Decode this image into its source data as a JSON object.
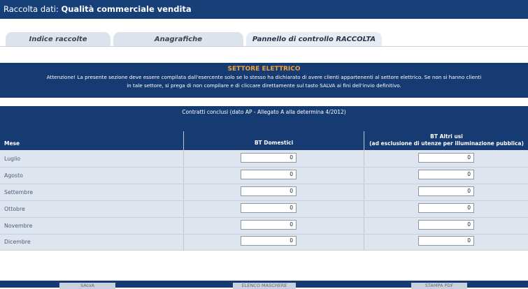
{
  "header": {
    "prefix": "Raccolta dati:",
    "title": "Qualità commerciale vendita"
  },
  "tabs": [
    {
      "label": "Indice raccolte",
      "active": false
    },
    {
      "label": "Anagrafiche",
      "active": false
    },
    {
      "label": "Pannello di controllo RACCOLTA",
      "active": true
    }
  ],
  "notice": {
    "heading": "SETTORE ELETTRICO",
    "line1": "Attenzione! La presente sezione deve essere compilata dall'esercente solo se lo stesso ha dichiarato di avere clienti appartenenti al settore elettrico. Se non si hanno clienti",
    "line2": "in tale settore, si prega di non compilare e di cliccare direttamente sul tasto SALVA ai fini dell'invio definitivo."
  },
  "table": {
    "caption": "Contratti conclusi (dato AP - Allegato A alla determina 4/2012)",
    "col_month": "Mese",
    "col_bt_domestici": "BT Domestici",
    "col_bt_altri": "BT Altri usi",
    "col_bt_altri_note": "(ad esclusione di utenze per illuminazione pubblica)",
    "rows": [
      {
        "month": "Luglio",
        "bt_domestici": "0",
        "bt_altri": "0"
      },
      {
        "month": "Agosto",
        "bt_domestici": "0",
        "bt_altri": "0"
      },
      {
        "month": "Settembre",
        "bt_domestici": "0",
        "bt_altri": "0"
      },
      {
        "month": "Ottobre",
        "bt_domestici": "0",
        "bt_altri": "0"
      },
      {
        "month": "Novembre",
        "bt_domestici": "0",
        "bt_altri": "0"
      },
      {
        "month": "Dicembre",
        "bt_domestici": "0",
        "bt_altri": "0"
      }
    ]
  },
  "buttons": {
    "save": "SALVA",
    "list": "ELENCO MASCHERE",
    "pdf": "STAMPA PDF"
  },
  "colors": {
    "header_bg": "#173f78",
    "accent": "#f0a33c",
    "grid_bg": "#dfe5ee"
  }
}
